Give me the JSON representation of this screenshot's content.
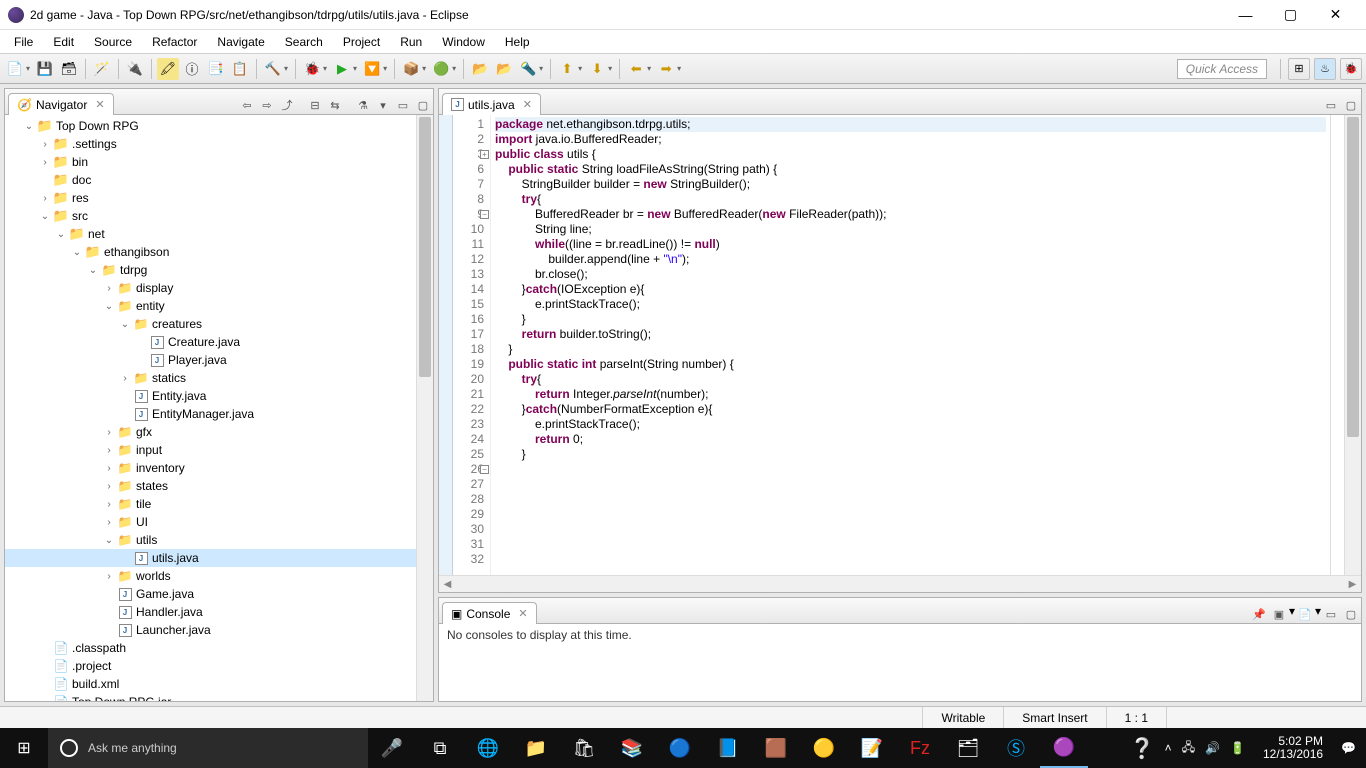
{
  "window": {
    "title": "2d game - Java - Top Down RPG/src/net/ethangibson/tdrpg/utils/utils.java - Eclipse"
  },
  "menu": [
    "File",
    "Edit",
    "Source",
    "Refactor",
    "Navigate",
    "Search",
    "Project",
    "Run",
    "Window",
    "Help"
  ],
  "quick_access": "Quick Access",
  "navigator": {
    "title": "Navigator",
    "project": "Top Down RPG",
    "selected": "utils.java",
    "tree": [
      {
        "d": 1,
        "t": "proj",
        "e": "v",
        "l": "Top Down RPG"
      },
      {
        "d": 2,
        "t": "folder",
        "e": ">",
        "l": ".settings"
      },
      {
        "d": 2,
        "t": "folder",
        "e": ">",
        "l": "bin"
      },
      {
        "d": 2,
        "t": "folder",
        "e": "",
        "l": "doc"
      },
      {
        "d": 2,
        "t": "folder",
        "e": ">",
        "l": "res"
      },
      {
        "d": 2,
        "t": "folder",
        "e": "v",
        "l": "src"
      },
      {
        "d": 3,
        "t": "folder",
        "e": "v",
        "l": "net"
      },
      {
        "d": 4,
        "t": "folder",
        "e": "v",
        "l": "ethangibson"
      },
      {
        "d": 5,
        "t": "pkg",
        "e": "v",
        "l": "tdrpg"
      },
      {
        "d": 6,
        "t": "pkg",
        "e": ">",
        "l": "display"
      },
      {
        "d": 6,
        "t": "pkg",
        "e": "v",
        "l": "entity"
      },
      {
        "d": 7,
        "t": "pkg",
        "e": "v",
        "l": "creatures"
      },
      {
        "d": 8,
        "t": "java",
        "e": "",
        "l": "Creature.java"
      },
      {
        "d": 8,
        "t": "java",
        "e": "",
        "l": "Player.java"
      },
      {
        "d": 7,
        "t": "pkg",
        "e": ">",
        "l": "statics"
      },
      {
        "d": 7,
        "t": "java",
        "e": "",
        "l": "Entity.java"
      },
      {
        "d": 7,
        "t": "java",
        "e": "",
        "l": "EntityManager.java"
      },
      {
        "d": 6,
        "t": "pkg",
        "e": ">",
        "l": "gfx"
      },
      {
        "d": 6,
        "t": "pkg",
        "e": ">",
        "l": "input"
      },
      {
        "d": 6,
        "t": "pkg",
        "e": ">",
        "l": "inventory"
      },
      {
        "d": 6,
        "t": "pkg",
        "e": ">",
        "l": "states"
      },
      {
        "d": 6,
        "t": "pkg",
        "e": ">",
        "l": "tile"
      },
      {
        "d": 6,
        "t": "pkg",
        "e": ">",
        "l": "UI"
      },
      {
        "d": 6,
        "t": "pkg",
        "e": "v",
        "l": "utils"
      },
      {
        "d": 7,
        "t": "java",
        "e": "",
        "l": "utils.java",
        "sel": true
      },
      {
        "d": 6,
        "t": "pkg",
        "e": ">",
        "l": "worlds"
      },
      {
        "d": 6,
        "t": "java",
        "e": "",
        "l": "Game.java"
      },
      {
        "d": 6,
        "t": "java",
        "e": "",
        "l": "Handler.java"
      },
      {
        "d": 6,
        "t": "java",
        "e": "",
        "l": "Launcher.java"
      },
      {
        "d": 2,
        "t": "file",
        "e": "",
        "l": ".classpath"
      },
      {
        "d": 2,
        "t": "file",
        "e": "",
        "l": ".project"
      },
      {
        "d": 2,
        "t": "file",
        "e": "",
        "l": "build.xml"
      },
      {
        "d": 2,
        "t": "file",
        "e": "",
        "l": "Top Down RPG.jar"
      }
    ]
  },
  "editor": {
    "tab": "utils.java",
    "lines": [
      {
        "n": 1,
        "h": true,
        "tok": [
          [
            "kw",
            "package"
          ],
          [
            "",
            " net.ethangibson.tdrpg.utils;"
          ]
        ]
      },
      {
        "n": 2,
        "tok": [
          [
            "",
            ""
          ]
        ]
      },
      {
        "n": 3,
        "fold": "+",
        "tok": [
          [
            "kw",
            "import"
          ],
          [
            "",
            " java.io.BufferedReader;"
          ]
        ]
      },
      {
        "n": 6,
        "tok": [
          [
            "",
            ""
          ]
        ]
      },
      {
        "n": 7,
        "tok": [
          [
            "kw",
            "public class"
          ],
          [
            "",
            " utils {"
          ]
        ]
      },
      {
        "n": 8,
        "tok": [
          [
            "",
            ""
          ]
        ]
      },
      {
        "n": 9,
        "fold": "-",
        "tok": [
          [
            "",
            "    "
          ],
          [
            "kw",
            "public static"
          ],
          [
            "",
            " String loadFileAsString(String path) {"
          ]
        ]
      },
      {
        "n": 10,
        "tok": [
          [
            "",
            "        StringBuilder builder = "
          ],
          [
            "kw",
            "new"
          ],
          [
            "",
            " StringBuilder();"
          ]
        ]
      },
      {
        "n": 11,
        "tok": [
          [
            "",
            ""
          ]
        ]
      },
      {
        "n": 12,
        "tok": [
          [
            "",
            "        "
          ],
          [
            "kw",
            "try"
          ],
          [
            "",
            "{"
          ]
        ]
      },
      {
        "n": 13,
        "tok": [
          [
            "",
            "            BufferedReader br = "
          ],
          [
            "kw",
            "new"
          ],
          [
            "",
            " BufferedReader("
          ],
          [
            "kw",
            "new"
          ],
          [
            "",
            " FileReader(path));"
          ]
        ]
      },
      {
        "n": 14,
        "tok": [
          [
            "",
            "            String line;"
          ]
        ]
      },
      {
        "n": 15,
        "tok": [
          [
            "",
            "            "
          ],
          [
            "kw",
            "while"
          ],
          [
            "",
            "((line = br.readLine()) != "
          ],
          [
            "kw",
            "null"
          ],
          [
            "",
            ")"
          ]
        ]
      },
      {
        "n": 16,
        "tok": [
          [
            "",
            "                builder.append(line + "
          ],
          [
            "str",
            "\"\\n\""
          ],
          [
            "",
            ");"
          ]
        ]
      },
      {
        "n": 17,
        "tok": [
          [
            "",
            ""
          ]
        ]
      },
      {
        "n": 18,
        "tok": [
          [
            "",
            "            br.close();"
          ]
        ]
      },
      {
        "n": 19,
        "tok": [
          [
            "",
            "        }"
          ],
          [
            "kw",
            "catch"
          ],
          [
            "",
            "(IOException e){"
          ]
        ]
      },
      {
        "n": 20,
        "tok": [
          [
            "",
            "            e.printStackTrace();"
          ]
        ]
      },
      {
        "n": 21,
        "tok": [
          [
            "",
            "        }"
          ]
        ]
      },
      {
        "n": 22,
        "tok": [
          [
            "",
            ""
          ]
        ]
      },
      {
        "n": 23,
        "tok": [
          [
            "",
            "        "
          ],
          [
            "kw",
            "return"
          ],
          [
            "",
            " builder.toString();"
          ]
        ]
      },
      {
        "n": 24,
        "tok": [
          [
            "",
            "    }"
          ]
        ]
      },
      {
        "n": 25,
        "tok": [
          [
            "",
            ""
          ]
        ]
      },
      {
        "n": 26,
        "fold": "-",
        "tok": [
          [
            "",
            "    "
          ],
          [
            "kw",
            "public static int"
          ],
          [
            "",
            " parseInt(String number) {"
          ]
        ]
      },
      {
        "n": 27,
        "tok": [
          [
            "",
            "        "
          ],
          [
            "kw",
            "try"
          ],
          [
            "",
            "{"
          ]
        ]
      },
      {
        "n": 28,
        "tok": [
          [
            "",
            "            "
          ],
          [
            "kw",
            "return"
          ],
          [
            "",
            " Integer."
          ],
          [
            "mth",
            "parseInt"
          ],
          [
            "",
            "(number);"
          ]
        ]
      },
      {
        "n": 29,
        "tok": [
          [
            "",
            "        }"
          ],
          [
            "kw",
            "catch"
          ],
          [
            "",
            "(NumberFormatException e){"
          ]
        ]
      },
      {
        "n": 30,
        "tok": [
          [
            "",
            "            e.printStackTrace();"
          ]
        ]
      },
      {
        "n": 31,
        "tok": [
          [
            "",
            "            "
          ],
          [
            "kw",
            "return"
          ],
          [
            "",
            " 0;"
          ]
        ]
      },
      {
        "n": 32,
        "tok": [
          [
            "",
            "        }"
          ]
        ]
      }
    ]
  },
  "console": {
    "title": "Console",
    "message": "No consoles to display at this time."
  },
  "status": {
    "writable": "Writable",
    "insert": "Smart Insert",
    "pos": "1 : 1"
  },
  "taskbar": {
    "cortana": "Ask me anything",
    "time": "5:02 PM",
    "date": "12/13/2016"
  }
}
